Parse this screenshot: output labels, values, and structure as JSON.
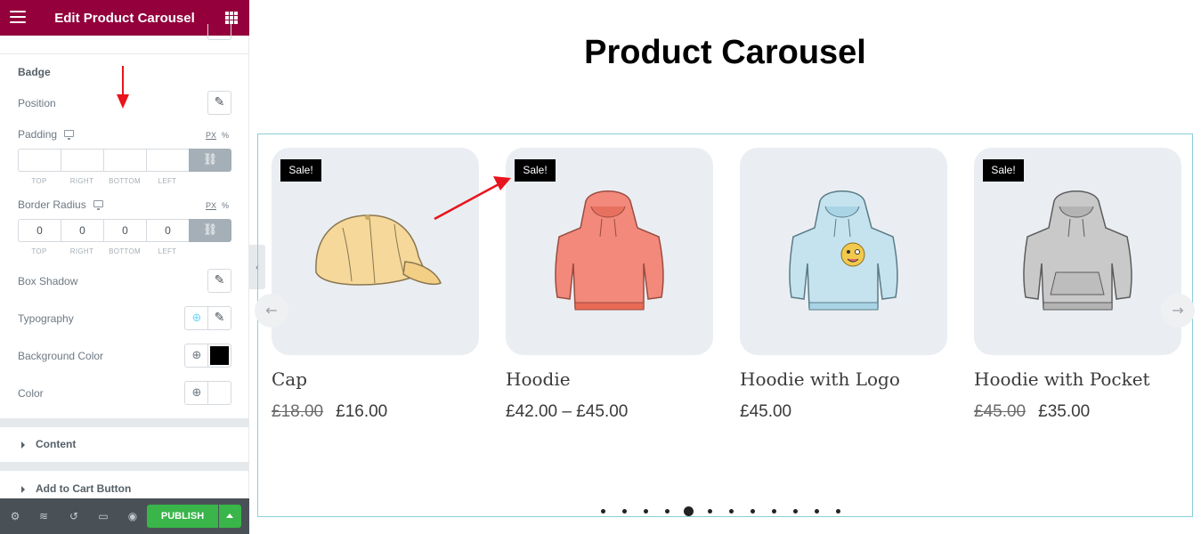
{
  "sidebar": {
    "header_title": "Edit Product Carousel",
    "section_title": "Badge",
    "position_label": "Position",
    "padding_label": "Padding",
    "border_radius_label": "Border Radius",
    "unit_px": "PX",
    "unit_pct": "%",
    "dim_labels": [
      "TOP",
      "RIGHT",
      "BOTTOM",
      "LEFT"
    ],
    "padding_values": [
      "",
      "",
      "",
      ""
    ],
    "radius_values": [
      "0",
      "0",
      "0",
      "0"
    ],
    "box_shadow_label": "Box Shadow",
    "typography_label": "Typography",
    "bg_color_label": "Background Color",
    "bg_color_value": "#000000",
    "color_label": "Color",
    "sections": [
      "Content",
      "Add to Cart Button"
    ],
    "publish_label": "PUBLISH",
    "colors": {
      "header": "#93003c",
      "footer": "#495157",
      "publish": "#39b54a"
    }
  },
  "main": {
    "title": "Product Carousel",
    "products": [
      {
        "name": "Cap",
        "badge": "Sale!",
        "old_price": "£18.00",
        "price": "£16.00",
        "image": "cap-image"
      },
      {
        "name": "Hoodie",
        "badge": "Sale!",
        "old_price": "",
        "price": "£42.00 – £45.00",
        "image": "red-hoodie-image"
      },
      {
        "name": "Hoodie with Logo",
        "badge": "",
        "old_price": "",
        "price": "£45.00",
        "image": "blue-hoodie-logo-image"
      },
      {
        "name": "Hoodie with Pocket",
        "badge": "Sale!",
        "old_price": "£45.00",
        "price": "£35.00",
        "image": "gray-hoodie-pocket-image"
      }
    ],
    "dots_count": 12,
    "active_dot": 4
  }
}
